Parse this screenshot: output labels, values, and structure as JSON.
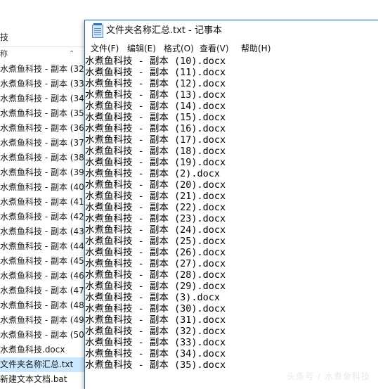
{
  "explorer": {
    "address_fragment": "技",
    "column_header": "称",
    "files": [
      {
        "name": "水煮鱼科技 - 副本 (32",
        "selected": false
      },
      {
        "name": "水煮鱼科技 - 副本 (33",
        "selected": false
      },
      {
        "name": "水煮鱼科技 - 副本 (34",
        "selected": false
      },
      {
        "name": "水煮鱼科技 - 副本 (35",
        "selected": false
      },
      {
        "name": "水煮鱼科技 - 副本 (36",
        "selected": false
      },
      {
        "name": "水煮鱼科技 - 副本 (37",
        "selected": false
      },
      {
        "name": "水煮鱼科技 - 副本 (38",
        "selected": false
      },
      {
        "name": "水煮鱼科技 - 副本 (39",
        "selected": false
      },
      {
        "name": "水煮鱼科技 - 副本 (40",
        "selected": false
      },
      {
        "name": "水煮鱼科技 - 副本 (41",
        "selected": false
      },
      {
        "name": "水煮鱼科技 - 副本 (42",
        "selected": false
      },
      {
        "name": "水煮鱼科技 - 副本 (43",
        "selected": false
      },
      {
        "name": "水煮鱼科技 - 副本 (44",
        "selected": false
      },
      {
        "name": "水煮鱼科技 - 副本 (45",
        "selected": false
      },
      {
        "name": "水煮鱼科技 - 副本 (46",
        "selected": false
      },
      {
        "name": "水煮鱼科技 - 副本 (47",
        "selected": false
      },
      {
        "name": "水煮鱼科技 - 副本 (48",
        "selected": false
      },
      {
        "name": "水煮鱼科技 - 副本 (49",
        "selected": false
      },
      {
        "name": "水煮鱼科技 - 副本 (50",
        "selected": false
      },
      {
        "name": "水煮鱼科技.docx",
        "selected": false
      },
      {
        "name": "文件夹名称汇总.txt",
        "selected": true
      },
      {
        "name": "新建文本文档.bat",
        "selected": false
      }
    ]
  },
  "notepad": {
    "title": "文件夹名称汇总.txt - 记事本",
    "menu": [
      "文件(F)",
      "编辑(E)",
      "格式(O)",
      "查看(V)",
      "帮助(H)"
    ],
    "lines": [
      "水煮鱼科技 - 副本 (10).docx",
      "水煮鱼科技 - 副本 (11).docx",
      "水煮鱼科技 - 副本 (12).docx",
      "水煮鱼科技 - 副本 (13).docx",
      "水煮鱼科技 - 副本 (14).docx",
      "水煮鱼科技 - 副本 (15).docx",
      "水煮鱼科技 - 副本 (16).docx",
      "水煮鱼科技 - 副本 (17).docx",
      "水煮鱼科技 - 副本 (18).docx",
      "水煮鱼科技 - 副本 (19).docx",
      "水煮鱼科技 - 副本 (2).docx",
      "水煮鱼科技 - 副本 (20).docx",
      "水煮鱼科技 - 副本 (21).docx",
      "水煮鱼科技 - 副本 (22).docx",
      "水煮鱼科技 - 副本 (23).docx",
      "水煮鱼科技 - 副本 (24).docx",
      "水煮鱼科技 - 副本 (25).docx",
      "水煮鱼科技 - 副本 (26).docx",
      "水煮鱼科技 - 副本 (27).docx",
      "水煮鱼科技 - 副本 (28).docx",
      "水煮鱼科技 - 副本 (29).docx",
      "水煮鱼科技 - 副本 (3).docx",
      "水煮鱼科技 - 副本 (30).docx",
      "水煮鱼科技 - 副本 (31).docx",
      "水煮鱼科技 - 副本 (32).docx",
      "水煮鱼科技 - 副本 (33).docx",
      "水煮鱼科技 - 副本 (34).docx",
      "水煮鱼科技 - 副本 (35).docx"
    ]
  },
  "watermark": "头条号 / 水煮鱼科技",
  "colors": {
    "selection": "#cce8ff",
    "window_border": "#1565c0"
  }
}
